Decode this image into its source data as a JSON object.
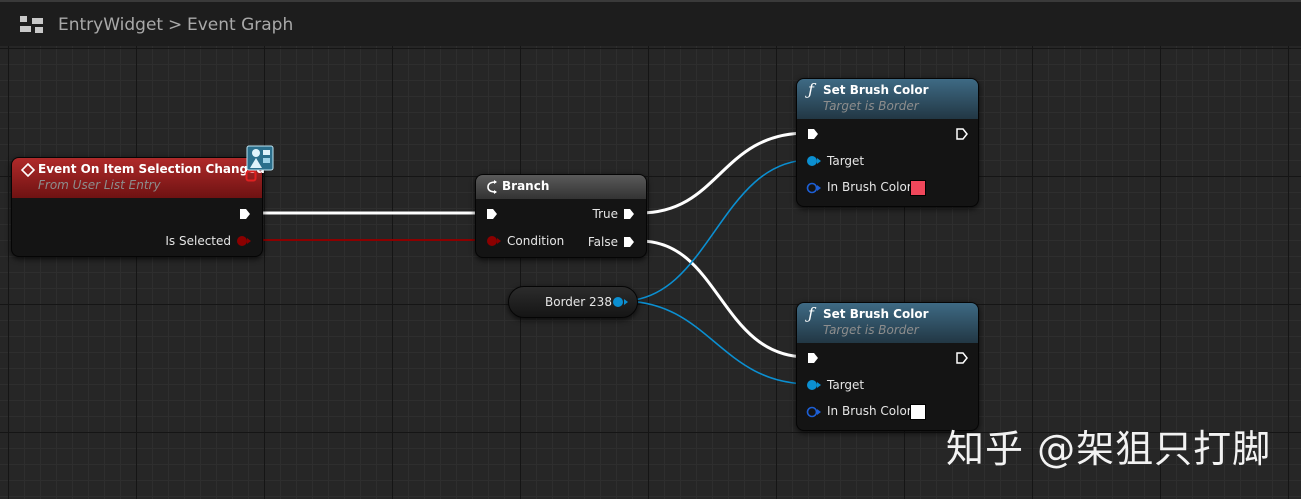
{
  "breadcrumb": {
    "widget": "EntryWidget",
    "separator": ">",
    "graph": "Event Graph"
  },
  "event_node": {
    "title": "Event On Item Selection Changed",
    "subtitle": "From User List Entry",
    "pin_is_selected": "Is Selected"
  },
  "branch_node": {
    "title": "Branch",
    "pin_condition": "Condition",
    "pin_true": "True",
    "pin_false": "False"
  },
  "variable_node": {
    "label": "Border 238"
  },
  "set_brush_top": {
    "title": "Set Brush Color",
    "subtitle": "Target is Border",
    "pin_target": "Target",
    "pin_color": "In Brush Color",
    "color_value": "#f0475b"
  },
  "set_brush_bottom": {
    "title": "Set Brush Color",
    "subtitle": "Target is Border",
    "pin_target": "Target",
    "pin_color": "In Brush Color",
    "color_value": "#ffffff"
  },
  "watermark": "知乎 @架狙只打脚",
  "colors": {
    "exec_wire": "#ffffff",
    "bool_wire": "#8c0000",
    "object_wire": "#0b8fd1",
    "event_header": "#8b1a1a",
    "function_header": "#2f4b5e"
  }
}
